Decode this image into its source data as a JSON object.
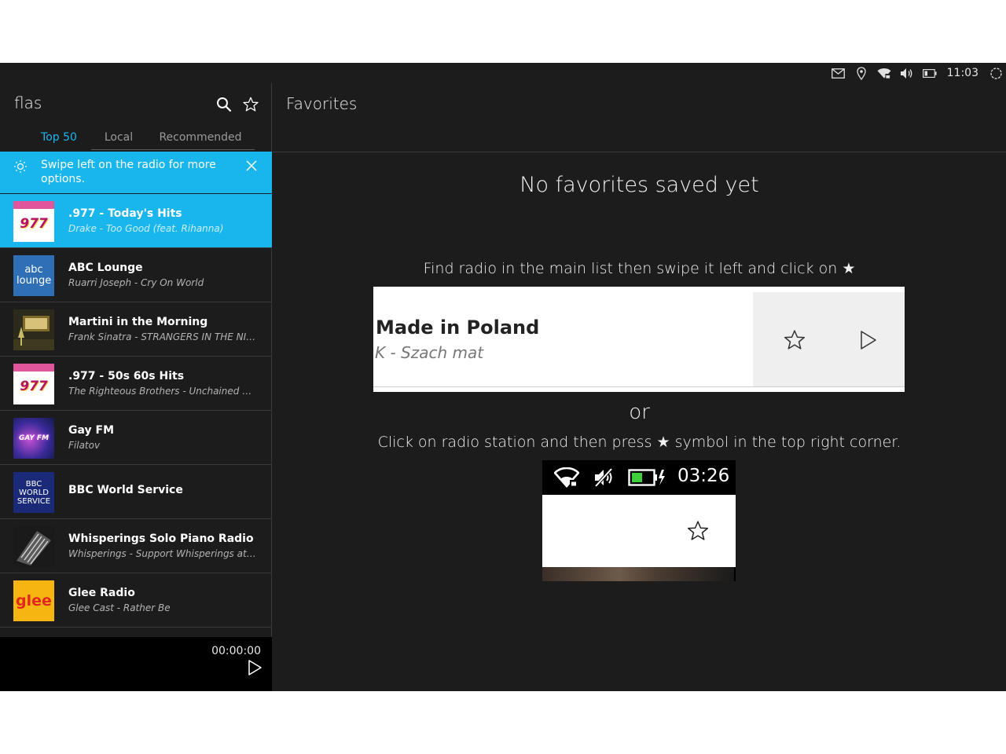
{
  "status_bar": {
    "time": "11:03",
    "icons": [
      "envelope-icon",
      "location-icon",
      "wifi-icon",
      "volume-icon",
      "battery-icon",
      "power-icon"
    ]
  },
  "app": {
    "title": "flas"
  },
  "tabs": [
    {
      "label": "Top 50",
      "active": true
    },
    {
      "label": "Local",
      "active": false
    },
    {
      "label": "Recommended",
      "active": false
    }
  ],
  "hint": {
    "text": "Swipe left on the radio for more options."
  },
  "stations": [
    {
      "name": ".977 - Today's Hits",
      "subtitle": "Drake - Too Good (feat. Rihanna)",
      "logo": "977",
      "selected": true
    },
    {
      "name": "ABC Lounge",
      "subtitle": "Ruarri Joseph - Cry On World",
      "logo": "abc lounge",
      "selected": false
    },
    {
      "name": "Martini in the Morning",
      "subtitle": "Frank Sinatra - STRANGERS IN THE NIGHT",
      "logo": "martini",
      "selected": false
    },
    {
      "name": ".977 - 50s 60s Hits",
      "subtitle": "The Righteous Brothers - Unchained Melody",
      "logo": "977",
      "selected": false
    },
    {
      "name": "Gay FM",
      "subtitle": "Filatov",
      "logo": "GAY FM",
      "selected": false
    },
    {
      "name": "BBC World Service",
      "subtitle": "",
      "logo": "BBC WORLD SERVICE",
      "selected": false
    },
    {
      "name": "Whisperings Solo Piano Radio",
      "subtitle": "Whisperings - Support Whisperings at Solo Piano Radio",
      "logo": "piano",
      "selected": false
    },
    {
      "name": "Glee Radio",
      "subtitle": "Glee Cast - Rather Be",
      "logo": "glee",
      "selected": false
    }
  ],
  "player": {
    "elapsed": "00:00:00"
  },
  "favorites": {
    "title": "Favorites",
    "empty_message": "No favorites saved yet",
    "instruction_swipe": "Find radio in the main list then swipe it left and click on ★",
    "demo_station_name": "Made in Poland",
    "demo_station_subtitle": "K - Szach mat",
    "or_text": "or",
    "instruction_click": "Click on radio station and then press ★ symbol in the top right corner.",
    "phone_time": "03:26"
  },
  "colors": {
    "accent": "#19b6ee",
    "background": "#1c1c1c",
    "player_bg": "#000000"
  }
}
